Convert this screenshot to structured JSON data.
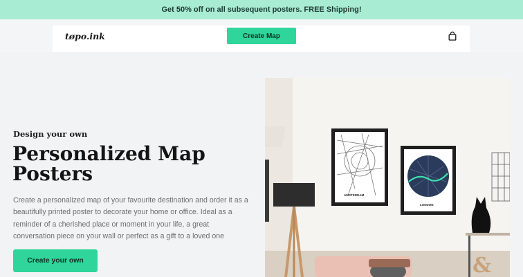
{
  "promo": {
    "text": "Get 50% off on all subsequent posters. FREE Shipping!"
  },
  "nav": {
    "logo": "tøpo.ink",
    "create_map_label": "Create Map",
    "bag_icon": "shopping-bag-icon"
  },
  "hero": {
    "eyebrow": "Design your own",
    "headline": "Personalized Map Posters",
    "description": "Create a personalized map of your favourite destination and order it as a beautifully printed poster to decorate your home or office. Ideal as a reminder of a cherished place or moment in your life, a great conversation piece on your wall or perfect as a gift to a loved one",
    "cta_label": "Create your own",
    "image": {
      "poster_left_label": "AMSTERDAM",
      "poster_right_label": "LONDON"
    }
  },
  "colors": {
    "accent": "#2fd59a",
    "promo_bg": "#a8ecd4",
    "text_dark": "#141414",
    "text_muted": "#6e6e6e"
  }
}
